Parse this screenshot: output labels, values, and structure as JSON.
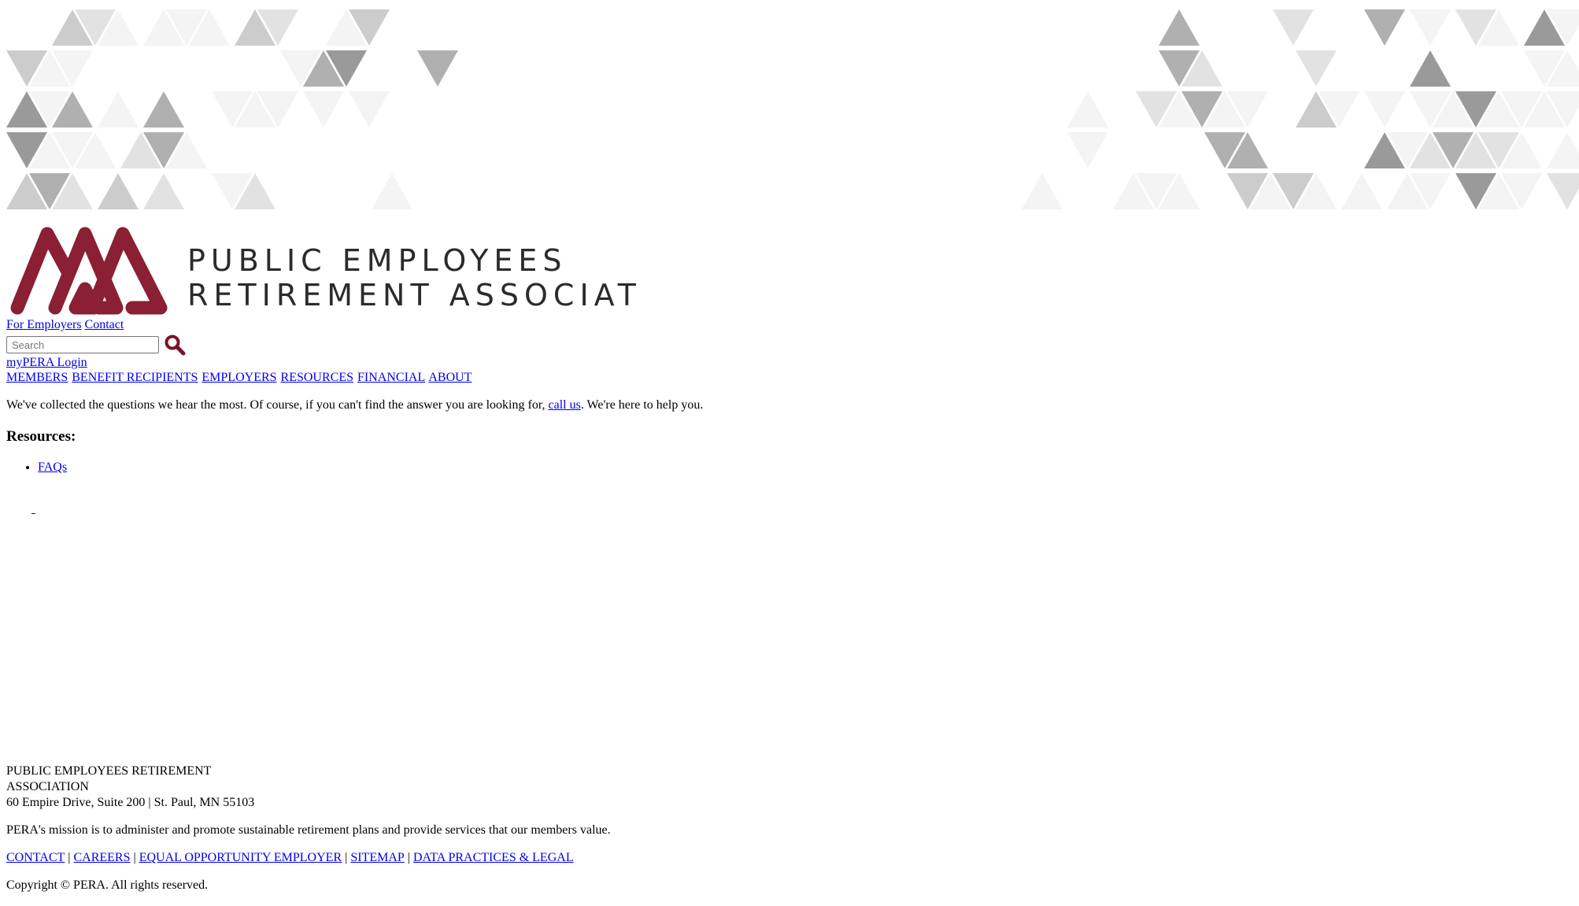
{
  "header": {
    "logo_line1": "PUBLIC EMPLOYEES",
    "logo_line2": "RETIREMENT ASSOCIATION",
    "logo_color": "#8b1f33",
    "utility_links": [
      "For Employers",
      "Contact"
    ],
    "search": {
      "placeholder": "Search",
      "icon": "search-icon",
      "icon_color": "#7a1328"
    },
    "login_link": "myPERA Login"
  },
  "nav": {
    "items": [
      "MEMBERS",
      "BENEFIT RECIPIENTS",
      "EMPLOYERS",
      "RESOURCES",
      "FINANCIAL",
      "ABOUT"
    ]
  },
  "main": {
    "intro_before": "We've collected the questions we hear the most. Of course, if you can't find the answer you are looking for, ",
    "intro_link": "call us",
    "intro_after": ". We're here to help you.",
    "resources_heading": "Resources:",
    "resources": [
      "FAQs"
    ],
    "stray_link": "_"
  },
  "footer": {
    "org_name": "PUBLIC EMPLOYEES RETIREMENT ASSOCIATION",
    "address": "60 Empire Drive, Suite 200 | St. Paul, MN 55103",
    "mission": "PERA's mission is to administer and promote sustainable retirement plans and provide services that our members value.",
    "links": [
      "CONTACT",
      "CAREERS",
      "EQUAL OPPORTUNITY EMPLOYER",
      "SITEMAP",
      "DATA PRACTICES & LEGAL"
    ],
    "separator": "|",
    "copyright": "Copyright © PERA. All rights reserved."
  },
  "colors": {
    "link": "#0000ee",
    "triangle_pattern": [
      "#f4f4f4",
      "#e2e2e2",
      "#cccccc",
      "#b0b0b0",
      "#9a9a9a"
    ]
  }
}
